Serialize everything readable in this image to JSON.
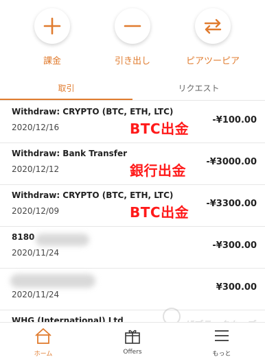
{
  "actions": [
    {
      "label": "課金",
      "icon": "plus-icon"
    },
    {
      "label": "引き出し",
      "icon": "minus-icon"
    },
    {
      "label": "ピアツーピア",
      "icon": "swap-arrows-icon"
    }
  ],
  "tabs": [
    {
      "label": "取引",
      "active": true
    },
    {
      "label": "リクエスト",
      "active": false
    }
  ],
  "transactions": [
    {
      "title": "Withdraw: CRYPTO (BTC, ETH, LTC)",
      "date": "2020/12/16",
      "amount": "-¥100.00",
      "note": "BTC出金"
    },
    {
      "title": "Withdraw: Bank Transfer",
      "date": "2020/12/12",
      "amount": "-¥3000.00",
      "note": "銀行出金"
    },
    {
      "title": "Withdraw: CRYPTO (BTC, ETH, LTC)",
      "date": "2020/12/09",
      "amount": "-¥3300.00",
      "note": "BTC出金"
    },
    {
      "title": "8180",
      "date": "2020/11/24",
      "amount": "-¥300.00",
      "note": ""
    },
    {
      "title": "",
      "date": "2020/11/24",
      "amount": "¥300.00",
      "note": ""
    },
    {
      "title": "WHG (International) Ltd",
      "date": "",
      "amount": "",
      "note": ""
    }
  ],
  "nav": [
    {
      "label": "ホーム",
      "icon": "home-icon",
      "active": true
    },
    {
      "label": "Offers",
      "icon": "gift-icon",
      "active": false
    },
    {
      "label": "もっと",
      "icon": "menu-icon",
      "active": false
    }
  ],
  "watermark": "ザブラックカーズ",
  "colors": {
    "accent": "#e07b2e",
    "annotation": "#ff1a1a"
  }
}
